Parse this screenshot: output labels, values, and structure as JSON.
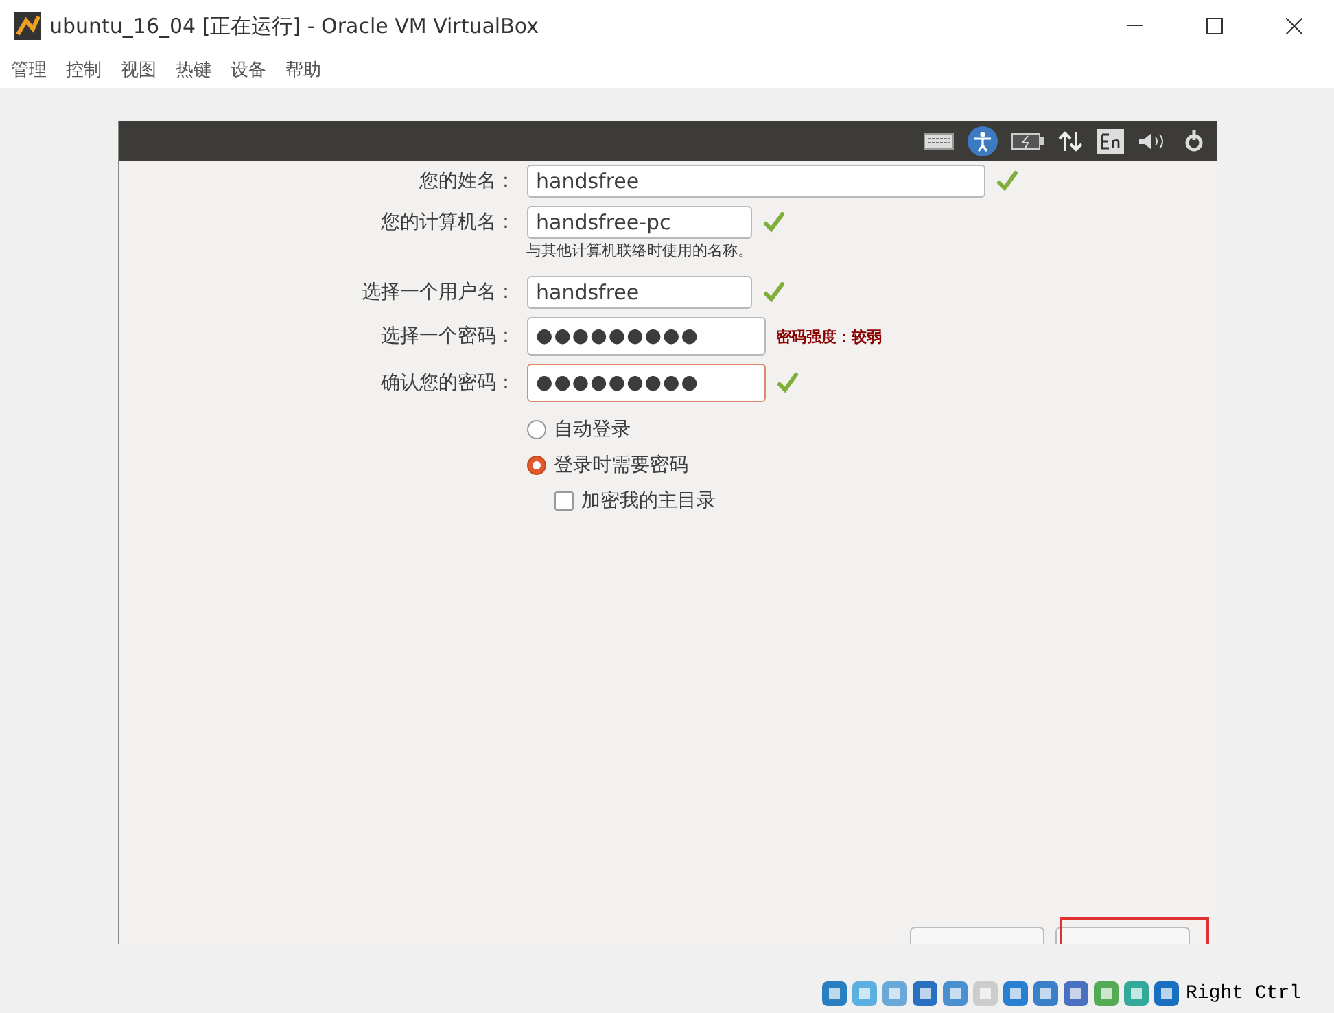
{
  "window": {
    "title": "ubuntu_16_04 [正在运行] - Oracle VM VirtualBox"
  },
  "menu": [
    "管理",
    "控制",
    "视图",
    "热键",
    "设备",
    "帮助"
  ],
  "form": {
    "fields": [
      {
        "label": "您的姓名：",
        "value": "handsfree",
        "kind": "text",
        "wide": true,
        "valid": true,
        "focused": false
      },
      {
        "label": "您的计算机名：",
        "value": "handsfree-pc",
        "kind": "text",
        "wide": false,
        "valid": true,
        "focused": false,
        "hint": "与其他计算机联络时使用的名称。"
      },
      {
        "label": "选择一个用户名：",
        "value": "handsfree",
        "kind": "text",
        "wide": false,
        "valid": true,
        "focused": false
      },
      {
        "label": "选择一个密码：",
        "value": "●●●●●●●●●",
        "kind": "password",
        "wide": false,
        "valid": false,
        "focused": false,
        "strength": "密码强度：较弱"
      },
      {
        "label": "确认您的密码：",
        "value": "●●●●●●●●●",
        "kind": "password",
        "wide": false,
        "valid": true,
        "focused": true
      }
    ],
    "login_options": [
      {
        "label": "自动登录",
        "selected": false
      },
      {
        "label": "登录时需要密码",
        "selected": true
      }
    ],
    "encrypt": {
      "label": "加密我的主目录",
      "checked": false
    }
  },
  "status_bar": {
    "host_key": "Right Ctrl"
  }
}
